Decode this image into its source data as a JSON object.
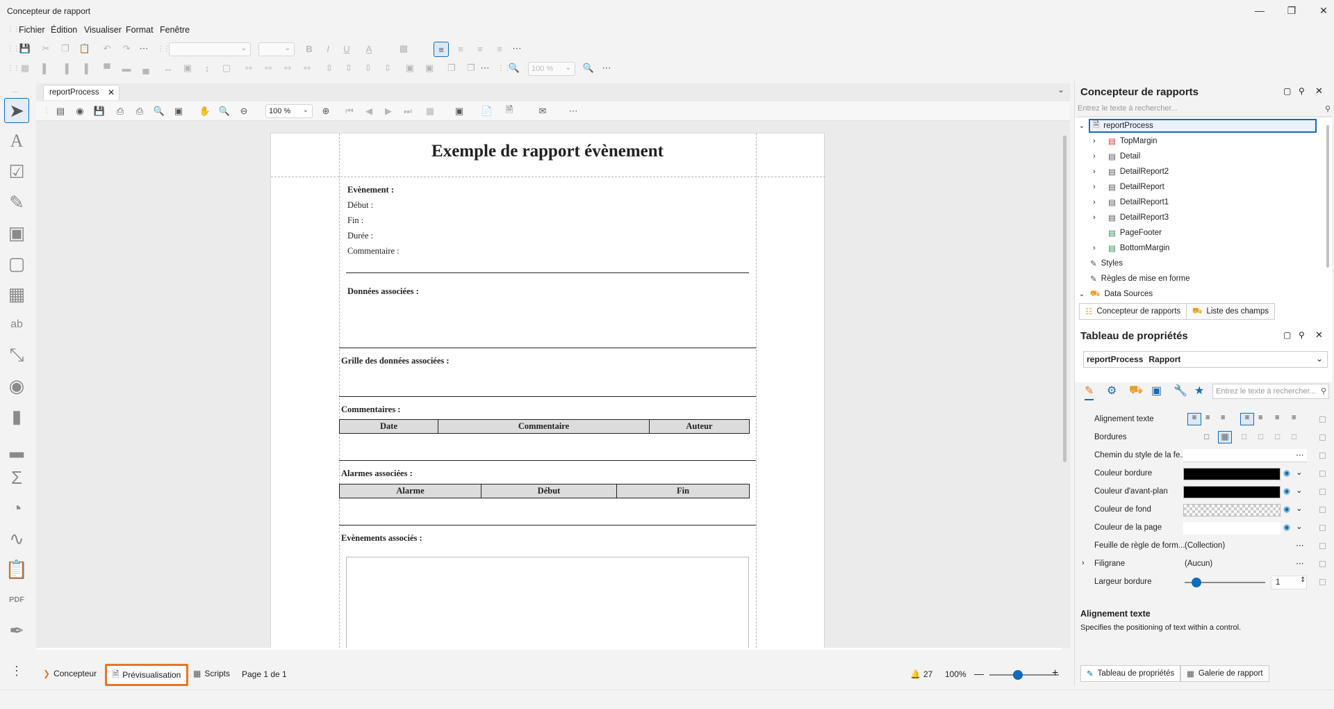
{
  "window": {
    "title": "Concepteur de rapport",
    "min_icon": "minimize-icon",
    "max_icon": "restore-icon",
    "close_icon": "close-icon"
  },
  "menu": [
    "Fichier",
    "Édition",
    "Visualiser",
    "Format",
    "Fenêtre"
  ],
  "toolbar": {
    "zoom_combo": "100 %"
  },
  "document_tab": {
    "label": "reportProcess"
  },
  "preview_toolbar": {
    "zoom": "100 %"
  },
  "report": {
    "title": "Exemple de rapport évènement",
    "event_label": "Evènement :",
    "start_label": "Début :",
    "end_label": "Fin :",
    "duration_label": "Durée :",
    "comment_label": "Commentaire :",
    "data_label": "Données associées :",
    "grid_label": "Grille des données associées :",
    "comments_label": "Commentaires :",
    "comments_table": [
      "Date",
      "Commentaire",
      "Auteur"
    ],
    "alarms_label": "Alarmes associées :",
    "alarms_table": [
      "Alarme",
      "Début",
      "Fin"
    ],
    "events_label": "Evènements associés :"
  },
  "status_bar": {
    "designer_tab": "Concepteur",
    "preview_tab": "Prévisualisation",
    "scripts_tab": "Scripts",
    "page_info": "Page 1 de 1",
    "notifications": "27",
    "zoom": "100%"
  },
  "report_explorer": {
    "title": "Concepteur de rapports",
    "search_placeholder": "Entrez le texte à rechercher...",
    "root": "reportProcess",
    "items": [
      "TopMargin",
      "Detail",
      "DetailReport2",
      "DetailReport",
      "DetailReport1",
      "DetailReport3",
      "PageFooter",
      "BottomMargin"
    ],
    "styles": "Styles",
    "rules": "Règles de mise en forme",
    "data_sources": "Data Sources",
    "tab1": "Concepteur de rapports",
    "tab2": "Liste des champs"
  },
  "properties": {
    "title": "Tableau de propriétés",
    "selected_name": "reportProcess",
    "selected_type": "Rapport",
    "search_placeholder": "Entrez le texte à rechercher...",
    "rows": [
      {
        "label": "Alignement texte",
        "value": ""
      },
      {
        "label": "Bordures",
        "value": ""
      },
      {
        "label": "Chemin du style de la fe...",
        "value": ""
      },
      {
        "label": "Couleur bordure",
        "value": ""
      },
      {
        "label": "Couleur d'avant-plan",
        "value": ""
      },
      {
        "label": "Couleur de fond",
        "value": ""
      },
      {
        "label": "Couleur de la page",
        "value": ""
      },
      {
        "label": "Feuille de règle de form...",
        "value": "(Collection)"
      },
      {
        "label": "Filigrane",
        "value": "(Aucun)"
      },
      {
        "label": "Largeur bordure",
        "value": "1"
      }
    ],
    "desc_title": "Alignement texte",
    "desc_text": "Specifies the positioning of text within a control.",
    "tab1": "Tableau de propriétés",
    "tab2": "Galerie de rapport"
  },
  "colors": {
    "accent": "#0f6cbd",
    "preview_highlight": "#e87722",
    "border_color": "#000000",
    "forecolor": "#000000"
  }
}
